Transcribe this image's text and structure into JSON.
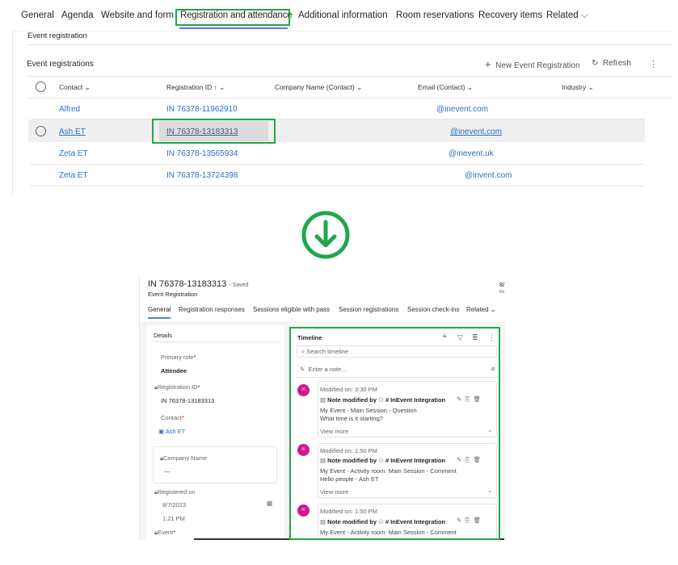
{
  "top": {
    "tabs": [
      "General",
      "Agenda",
      "Website and form",
      "Registration and attendance",
      "Additional information",
      "Room reservations",
      "Recovery items",
      "Related"
    ],
    "active_tab": "Registration and attendance",
    "section_title": "Event registration",
    "grid_title": "Event registrations",
    "new_button": "New Event Registration",
    "refresh_button": "Refresh",
    "columns": [
      "Contact",
      "Registration ID",
      "Company Name (Contact)",
      "Email (Contact)",
      "Industry"
    ],
    "rows": [
      {
        "contact": "Alfred",
        "id": "IN 76378-11962910",
        "email": "@inevent.com"
      },
      {
        "contact": "Ash ET",
        "id": "IN 76378-13183313",
        "email": "@inevent.com"
      },
      {
        "contact": "Zeta ET",
        "id": "IN 76378-13565934",
        "email": "@inevent.uk"
      },
      {
        "contact": "Zeta ET",
        "id": "IN 76378-13724398",
        "email": "@invent.com"
      }
    ]
  },
  "accent": "#22a64a",
  "record": {
    "title": "IN 76378-13183313",
    "status": "- Saved",
    "subtitle": "Event Registration",
    "corner": "8/",
    "corner2": "Re",
    "tabs": [
      "General",
      "Registration responses",
      "Sessions eligible with pass",
      "Session registrations",
      "Session check-ins",
      "Related"
    ],
    "details": {
      "title": "Details",
      "primary_role_label": "Primary role",
      "primary_role": "Attendee",
      "reg_id_label": "Registration ID",
      "reg_id": "IN 76378-13183313",
      "contact_label": "Contact",
      "contact": "Ash ET",
      "company_label": "Company Name",
      "company": "---",
      "registered_label": "Registered on",
      "reg_date": "8/7/2023",
      "reg_time": "1:21 PM",
      "event_label": "Event"
    },
    "timeline": {
      "title": "Timeline",
      "search_placeholder": "Search timeline",
      "note_placeholder": "Enter a note...",
      "entries": [
        {
          "avatar": "#I",
          "modified": "Modified on: 3:30 PM",
          "by": "Note modified by",
          "author": "# InEvent Integration",
          "line1": "My Event - Main Session - Question",
          "line2": "What time is it starting?",
          "more": "View more"
        },
        {
          "avatar": "#I",
          "modified": "Modified on: 1:50 PM",
          "by": "Note modified by",
          "author": "# InEvent Integration",
          "line1": "My Event - Activity room: Main Session - Comment",
          "line2": "Hello people - Ash ET",
          "more": "View more"
        },
        {
          "avatar": "#I",
          "modified": "Modified on: 1:50 PM",
          "by": "Note modified by",
          "author": "# InEvent Integration",
          "line1": "My Event - Activity room: Main Session - Comment"
        }
      ]
    }
  }
}
